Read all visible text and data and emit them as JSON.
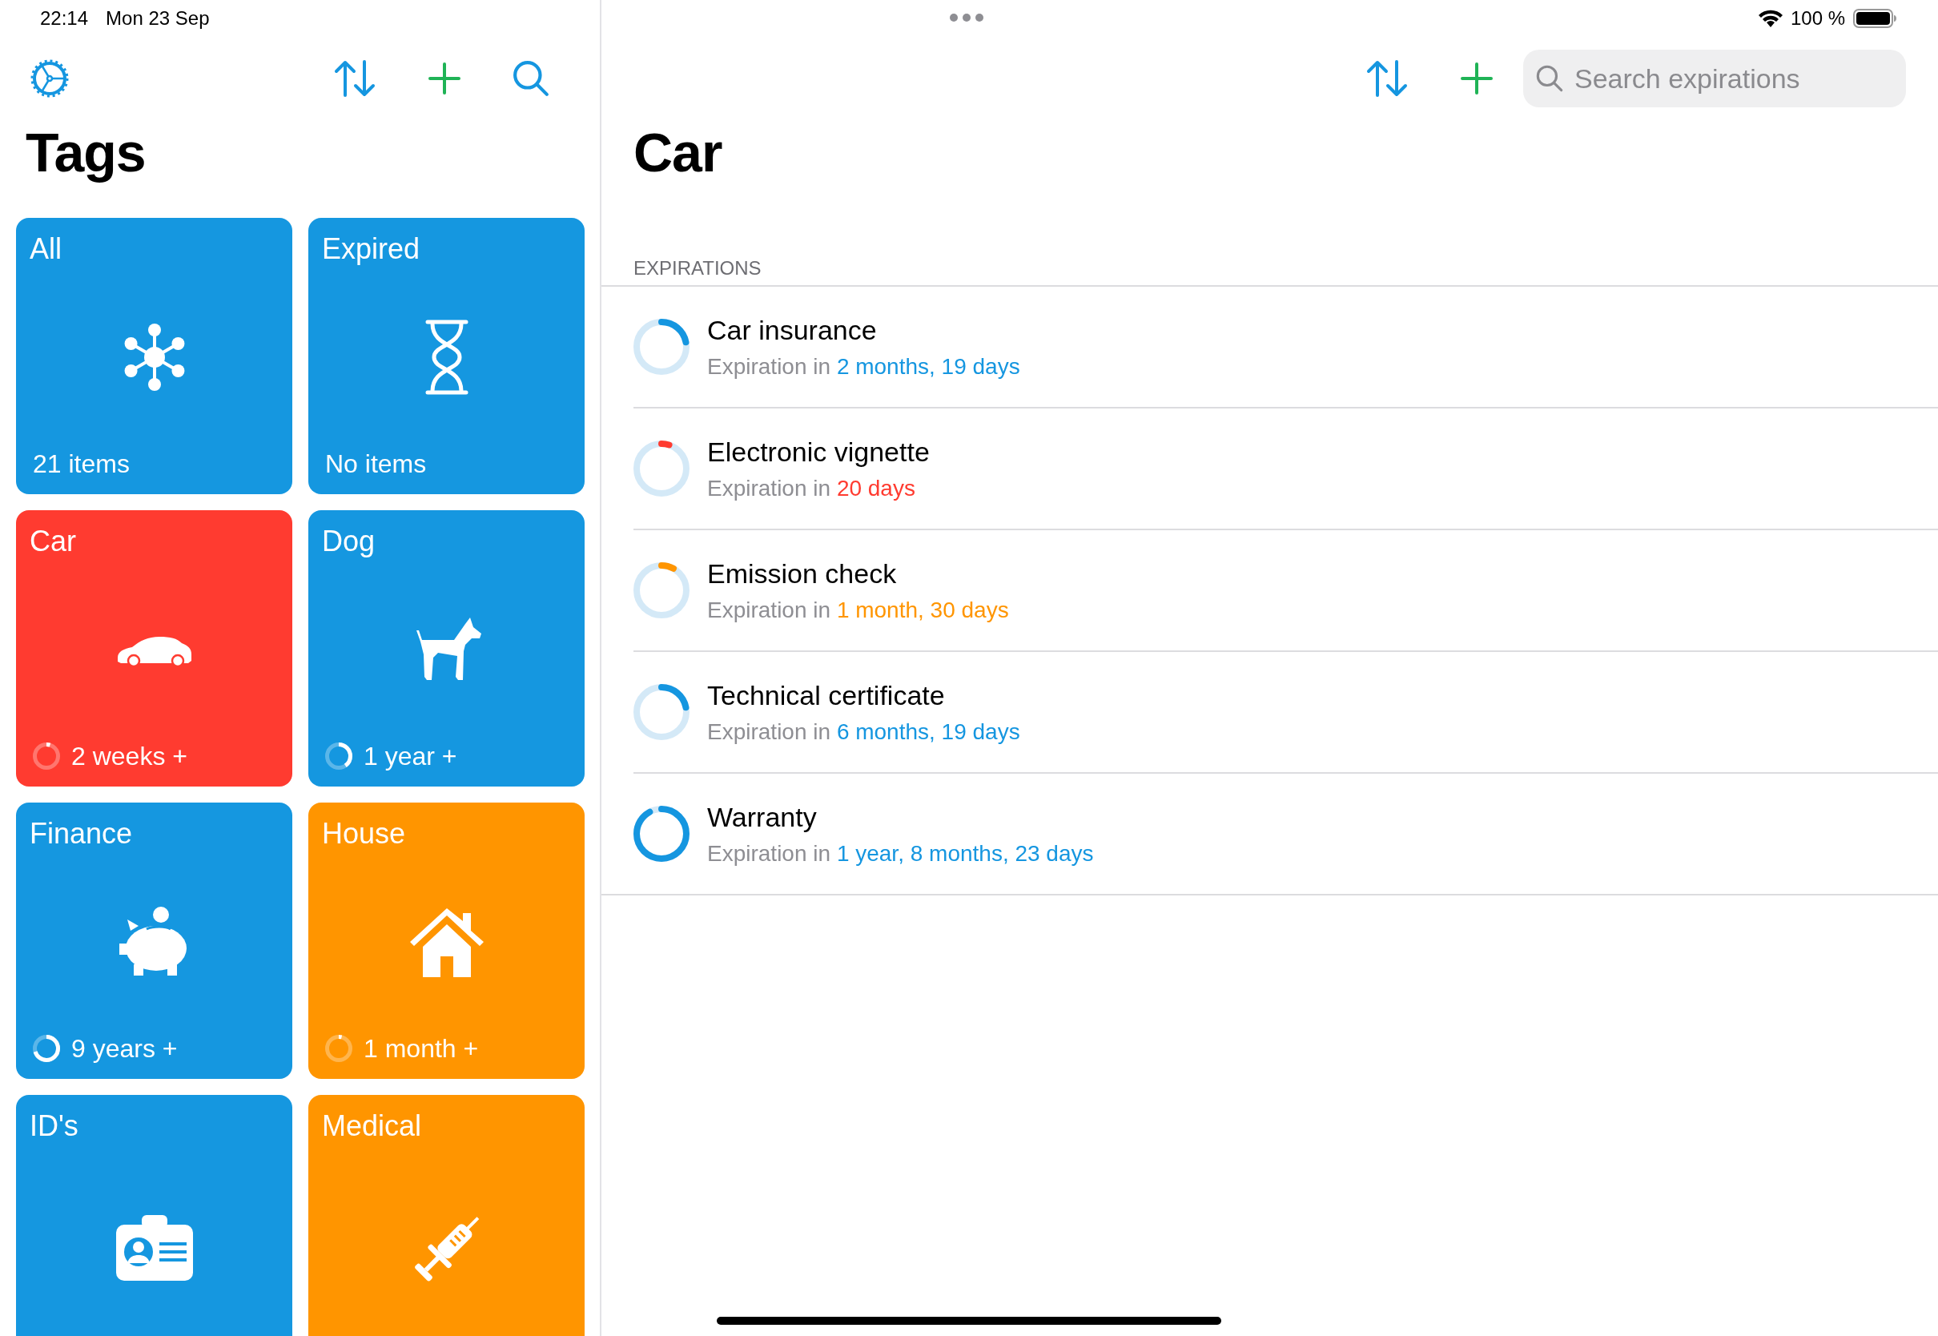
{
  "status_bar": {
    "time": "22:14",
    "date": "Mon 23 Sep",
    "battery": "100 %"
  },
  "sidebar": {
    "title": "Tags",
    "tiles": [
      {
        "name": "All",
        "footer": "21 items",
        "color": "#1597e0"
      },
      {
        "name": "Expired",
        "footer": "No items",
        "color": "#1597e0"
      },
      {
        "name": "Car",
        "footer": "2 weeks +",
        "level": 0.05,
        "color": "#ff3b30"
      },
      {
        "name": "Dog",
        "footer": "1 year +",
        "level": 0.4,
        "color": "#1597e0"
      },
      {
        "name": "Finance",
        "footer": "9 years +",
        "level": 0.7,
        "color": "#1597e0"
      },
      {
        "name": "House",
        "footer": "1 month +",
        "level": 0.04,
        "color": "#ff9500"
      },
      {
        "name": "ID's",
        "color": "#1597e0"
      },
      {
        "name": "Medical",
        "color": "#ff9500"
      }
    ]
  },
  "detail": {
    "title": "Car",
    "search": {
      "placeholder": "Search expirations"
    },
    "section": "EXPIRATIONS",
    "rows": [
      {
        "title": "Car insurance",
        "prefix": "Expiration in",
        "due": "2 months, 19 days",
        "color": "#1596e0",
        "level": 0.22
      },
      {
        "title": "Electronic vignette",
        "prefix": "Expiration in",
        "due": "20 days",
        "color": "#ff3b30",
        "level": 0.05
      },
      {
        "title": "Emission check",
        "prefix": "Expiration in",
        "due": "1 month, 30 days",
        "color": "#ff9500",
        "level": 0.08
      },
      {
        "title": "Technical certificate",
        "prefix": "Expiration in",
        "due": "6 months, 19 days",
        "color": "#1596e0",
        "level": 0.22
      },
      {
        "title": "Warranty",
        "prefix": "Expiration in",
        "due": "1 year, 8 months, 23 days",
        "color": "#1596e0",
        "level": 0.92
      }
    ]
  }
}
